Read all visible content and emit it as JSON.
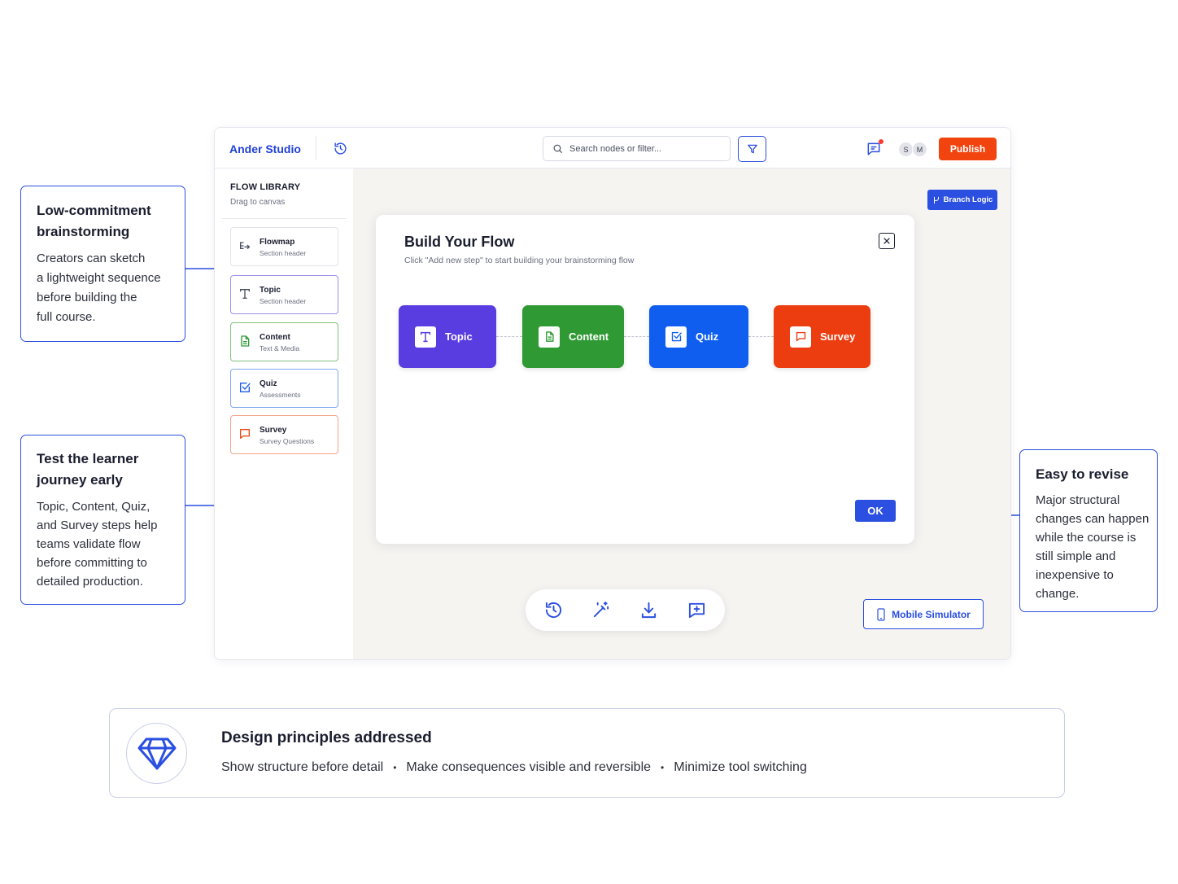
{
  "app": {
    "brand": "Ander Studio",
    "search_placeholder": "Search nodes or filter...",
    "avatars": [
      "S",
      "M"
    ],
    "publish_label": "Publish",
    "colors": {
      "accent": "#2b4fe0",
      "publish": "#f2440f",
      "notification_dot": "#ff3b30"
    }
  },
  "sidebar": {
    "title": "FLOW LIBRARY",
    "subtitle": "Drag to canvas",
    "items": [
      {
        "name": "Flowmap",
        "desc": "Section header",
        "icon": "flowmap-icon",
        "border": "#e2e4ea",
        "icon_color": "#4a4f60"
      },
      {
        "name": "Topic",
        "desc": "Section header",
        "icon": "text-t-icon",
        "border": "#9b8fe6",
        "icon_color": "#4a4f60"
      },
      {
        "name": "Content",
        "desc": "Text & Media",
        "icon": "document-icon",
        "border": "#7fc37f",
        "icon_color": "#2e9a36"
      },
      {
        "name": "Quiz",
        "desc": "Assessments",
        "icon": "checkbox-icon",
        "border": "#7fa8f0",
        "icon_color": "#1f5ce8"
      },
      {
        "name": "Survey",
        "desc": "Survey Questions",
        "icon": "speech-bubble-icon",
        "border": "#f2a48a",
        "icon_color": "#e8491a"
      }
    ]
  },
  "canvas": {
    "branch_logic_label": "Branch Logic",
    "mobile_simulator_label": "Mobile Simulator",
    "toolbar": [
      "history-icon",
      "magic-wand-icon",
      "download-icon",
      "comment-add-icon"
    ]
  },
  "modal": {
    "title": "Build Your Flow",
    "subtitle": "Click \"Add new step\" to start building your brainstorming flow",
    "ok_label": "OK",
    "steps": [
      {
        "label": "Topic",
        "color": "#5a3de0",
        "icon": "text-t-icon"
      },
      {
        "label": "Content",
        "color": "#2f9a34",
        "icon": "document-icon"
      },
      {
        "label": "Quiz",
        "color": "#0f5ef0",
        "icon": "checkbox-icon"
      },
      {
        "label": "Survey",
        "color": "#ec3d10",
        "icon": "speech-bubble-icon"
      }
    ]
  },
  "callouts": {
    "left_top": {
      "title_lines": [
        "Low-commitment",
        "brainstorming"
      ],
      "body_lines": [
        "Creators can sketch",
        "a lightweight sequence",
        "before building the",
        "full course."
      ]
    },
    "left_bottom": {
      "title_lines": [
        "Test the learner",
        "journey early"
      ],
      "body_lines": [
        "Topic, Content, Quiz,",
        "and Survey steps help",
        "teams validate flow",
        "before committing to",
        "detailed production."
      ]
    },
    "right": {
      "title_lines": [
        "Easy to revise"
      ],
      "body_lines": [
        "Major structural",
        "changes can happen",
        "while the course is",
        "still simple and",
        "inexpensive to",
        "change."
      ]
    }
  },
  "principles": {
    "icon": "diamond-gem-icon",
    "title": "Design principles addressed",
    "items": [
      "Show structure before detail",
      "Make consequences visible and reversible",
      "Minimize tool switching"
    ]
  }
}
